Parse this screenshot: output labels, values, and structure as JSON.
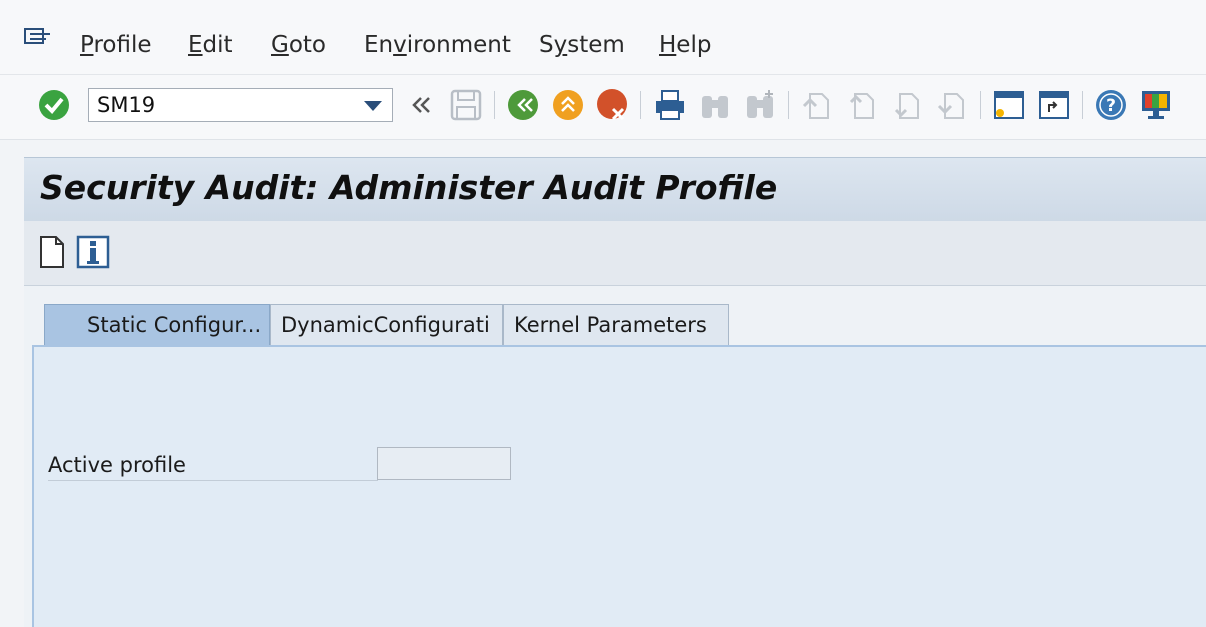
{
  "menubar": {
    "icon": "menu-icon",
    "items": [
      {
        "pre": "",
        "ul": "P",
        "post": "rofile"
      },
      {
        "pre": "",
        "ul": "E",
        "post": "dit"
      },
      {
        "pre": "",
        "ul": "G",
        "post": "oto"
      },
      {
        "pre": "En",
        "ul": "v",
        "post": "ironment"
      },
      {
        "pre": "S",
        "ul": "y",
        "post": "stem"
      },
      {
        "pre": "",
        "ul": "H",
        "post": "elp"
      }
    ]
  },
  "toolbar": {
    "command_value": "SM19",
    "icons": [
      "enter-icon",
      "back-history-icon",
      "save-icon",
      "back-icon",
      "exit-icon",
      "cancel-icon",
      "print-icon",
      "find-icon",
      "find-next-icon",
      "first-page-icon",
      "previous-page-icon",
      "next-page-icon",
      "last-page-icon",
      "create-session-icon",
      "shortcut-icon",
      "help-icon",
      "customize-layout-icon"
    ]
  },
  "title": "Security Audit: Administer Audit Profile",
  "app_toolbar": {
    "icons": [
      "new-document-icon",
      "information-icon"
    ]
  },
  "tabs": [
    {
      "label": "Static Configur...",
      "active": true
    },
    {
      "label": "DynamicConfigurati",
      "active": false
    },
    {
      "label": "Kernel Parameters",
      "active": false
    }
  ],
  "form": {
    "active_profile_label": "Active profile",
    "active_profile_value": ""
  },
  "colors": {
    "accent": "#a9c4e2",
    "title_band": "#cdd9e6",
    "enter_green": "#3aa340"
  }
}
